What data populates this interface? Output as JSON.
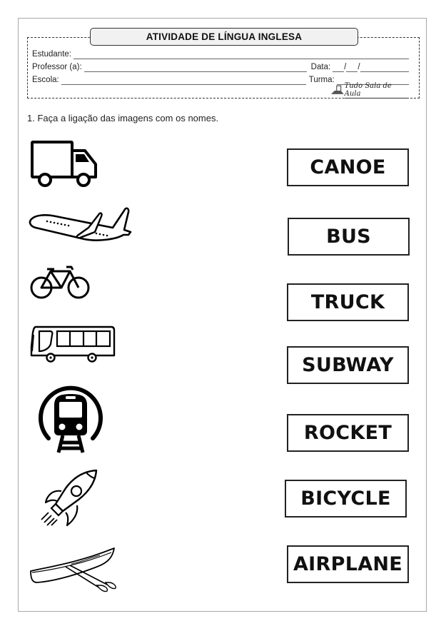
{
  "header": {
    "title": "ATIVIDADE DE LÍNGUA INGLESA",
    "fields": {
      "student_label": "Estudante:",
      "teacher_label": "Professor (a):",
      "date_label": "Data:",
      "date_separator": "/",
      "school_label": "Escola:",
      "class_label": "Turma:"
    },
    "logo_text": "Tudo Sala de Aula"
  },
  "exercise": {
    "instruction": "1. Faça a ligação das imagens com os nomes.",
    "images": [
      {
        "icon": "truck-icon"
      },
      {
        "icon": "airplane-icon"
      },
      {
        "icon": "bicycle-icon"
      },
      {
        "icon": "bus-icon"
      },
      {
        "icon": "subway-icon"
      },
      {
        "icon": "rocket-icon"
      },
      {
        "icon": "canoe-icon"
      }
    ],
    "words": [
      "CANOE",
      "BUS",
      "TRUCK",
      "SUBWAY",
      "ROCKET",
      "BICYCLE",
      "AIRPLANE"
    ]
  }
}
